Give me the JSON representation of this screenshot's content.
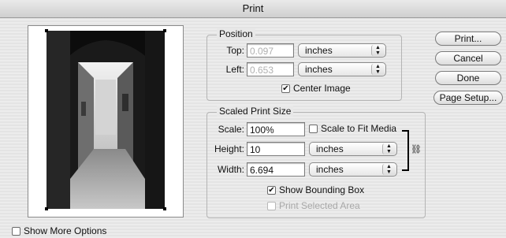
{
  "window": {
    "title": "Print"
  },
  "position": {
    "label": "Position",
    "top_label": "Top:",
    "top_value": "0.097",
    "left_label": "Left:",
    "left_value": "0.653",
    "unit": "inches",
    "center_image_label": "Center Image",
    "center_image_checked": true
  },
  "scaled": {
    "label": "Scaled Print Size",
    "scale_label": "Scale:",
    "scale_value": "100%",
    "scale_fit_label": "Scale to Fit Media",
    "height_label": "Height:",
    "height_value": "10",
    "width_label": "Width:",
    "width_value": "6.694",
    "unit": "inches",
    "bounding_box_label": "Show Bounding Box",
    "print_selected_label": "Print Selected Area"
  },
  "buttons": {
    "print": "Print...",
    "cancel": "Cancel",
    "done": "Done",
    "page_setup": "Page Setup..."
  },
  "more_options_label": "Show More Options",
  "icons": {
    "check": "checkmark-icon",
    "arrows": "popup-arrows-icon",
    "link": "chain-link-icon"
  }
}
